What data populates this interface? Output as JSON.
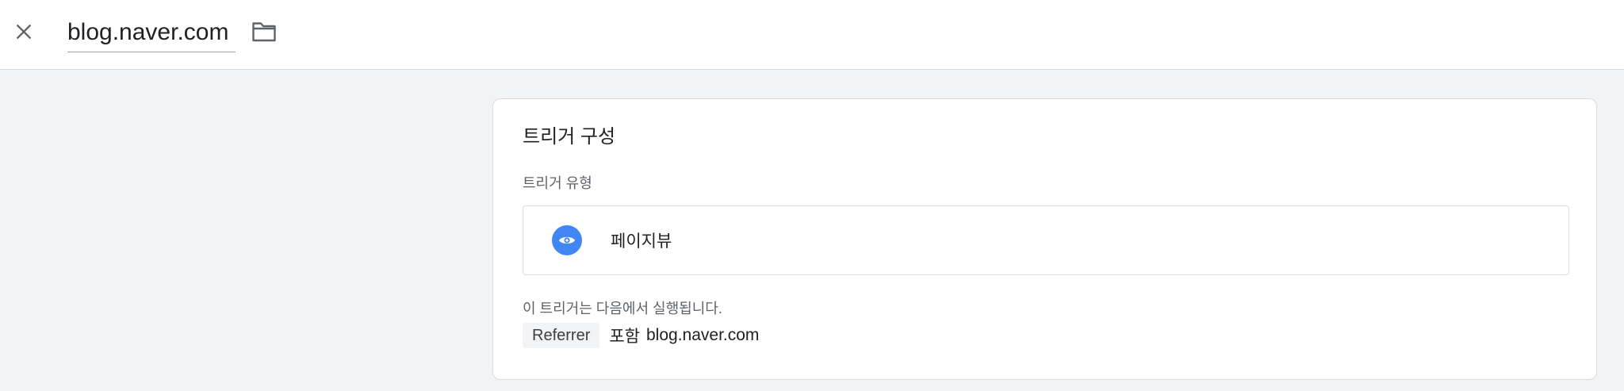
{
  "header": {
    "title": "blog.naver.com"
  },
  "icons": {
    "close": "close-icon",
    "folder": "folder-icon",
    "trigger_type": "eye-icon"
  },
  "colors": {
    "accent": "#4285f4",
    "page_background": "#f1f3f4",
    "card_background": "#ffffff",
    "border": "#dadce0",
    "secondary_text": "#5f6368"
  },
  "trigger_config": {
    "title": "트리거 구성",
    "type_label": "트리거 유형",
    "type_value": "페이지뷰",
    "fires_on_label": "이 트리거는 다음에서 실행됩니다.",
    "condition": {
      "variable": "Referrer",
      "operator": "포함",
      "value": "blog.naver.com"
    }
  }
}
